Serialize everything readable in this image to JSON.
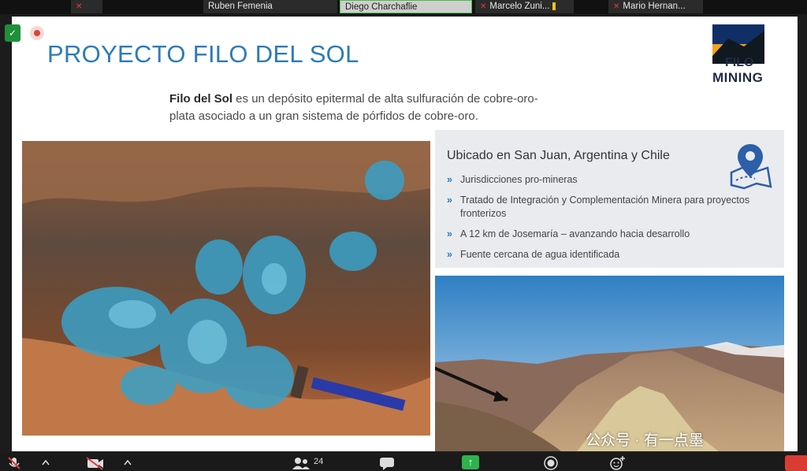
{
  "participants": [
    {
      "name": "Ruben Femenia",
      "muted": true
    },
    {
      "name": "Diego Charchaflie",
      "muted": false,
      "active": true
    },
    {
      "name": "Marcelo Zuni...",
      "muted": true
    },
    {
      "name": "Mario Hernan...",
      "muted": true
    }
  ],
  "slide": {
    "title": "PROYECTO FILO DEL SOL",
    "logo": {
      "line1": "FILO",
      "line2": "MINING"
    },
    "intro": {
      "bold": "Filo del Sol",
      "rest": " es un depósito epitermal de alta sulfuración de cobre-oro-plata asociado a un gran sistema de pórfidos de cobre-oro."
    },
    "panel": {
      "title": "Ubicado en San Juan, Argentina y Chile",
      "bullets": [
        "Jurisdicciones pro-mineras",
        "Tratado de Integración y Complementación Minera para proyectos fronterizos",
        "A 12 km de Josemaría – avanzando hacia desarrollo",
        "Fuente cercana de agua identificada"
      ]
    }
  },
  "watermark": "公众号 · 有一点墨",
  "toolbar": {
    "participants_count": "24"
  },
  "colors": {
    "title": "#2d7bb8",
    "panel_bg": "#e9ebef",
    "share_green": "#2fb24c",
    "end_red": "#d93c33"
  }
}
